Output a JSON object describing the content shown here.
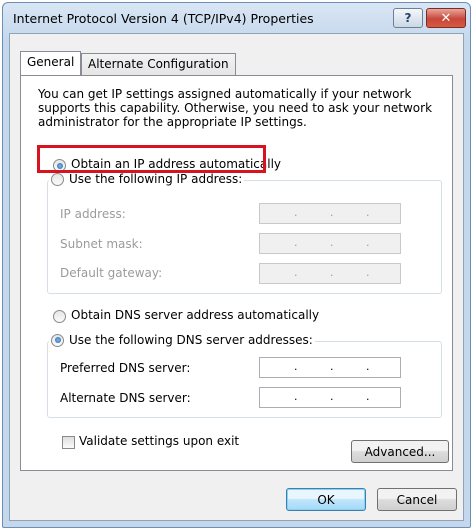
{
  "window": {
    "title": "Internet Protocol Version 4 (TCP/IPv4) Properties",
    "help_label": "?",
    "close_label": "✕"
  },
  "tabs": [
    {
      "label": "General",
      "active": true
    },
    {
      "label": "Alternate Configuration",
      "active": false
    }
  ],
  "description": "You can get IP settings assigned automatically if your network supports this capability. Otherwise, you need to ask your network administrator for the appropriate IP settings.",
  "ip": {
    "auto_label": "Obtain an IP address automatically",
    "auto_selected": true,
    "manual_label": "Use the following IP address:",
    "fields": [
      {
        "label": "IP address:",
        "value": " .  .  . "
      },
      {
        "label": "Subnet mask:",
        "value": " .  .  . "
      },
      {
        "label": "Default gateway:",
        "value": " .  .  . "
      }
    ]
  },
  "dns": {
    "auto_label": "Obtain DNS server address automatically",
    "manual_label": "Use the following DNS server addresses:",
    "manual_selected": true,
    "fields": [
      {
        "label": "Preferred DNS server:"
      },
      {
        "label": "Alternate DNS server:"
      }
    ]
  },
  "validate_label": "Validate settings upon exit",
  "validate_checked": false,
  "buttons": {
    "advanced": "Advanced...",
    "ok": "OK",
    "cancel": "Cancel"
  },
  "colors": {
    "highlight": "#d6131f",
    "accent": "#3c7fb1"
  }
}
